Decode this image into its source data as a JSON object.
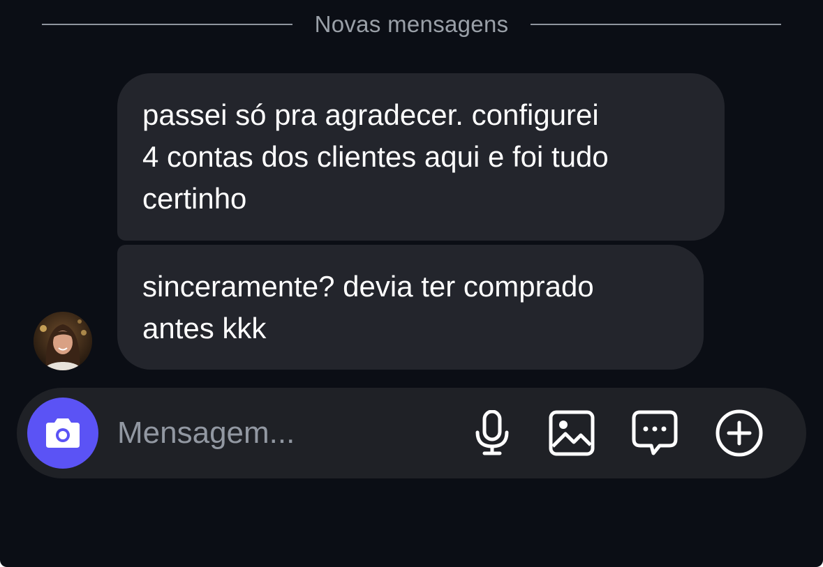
{
  "divider": {
    "label": "Novas mensagens"
  },
  "messages": [
    {
      "text": "passei só pra agradecer. configurei\n4 contas dos clientes aqui e foi tudo\ncertinho"
    },
    {
      "text": "sinceramente? devia ter comprado\nantes kkk"
    }
  ],
  "avatar": {
    "icon": "person-photo"
  },
  "composer": {
    "placeholder": "Mensagem...",
    "value": "",
    "camera_icon": "camera-icon",
    "mic_icon": "microphone-icon",
    "image_icon": "image-icon",
    "chat_icon": "chat-bubble-icon",
    "plus_icon": "plus-circle-icon",
    "accent_color": "#5b53f5"
  },
  "colors": {
    "background": "#0b0e15",
    "bubble": "#23252c",
    "composer": "#1f2126",
    "muted_text": "#9aa0a8"
  }
}
